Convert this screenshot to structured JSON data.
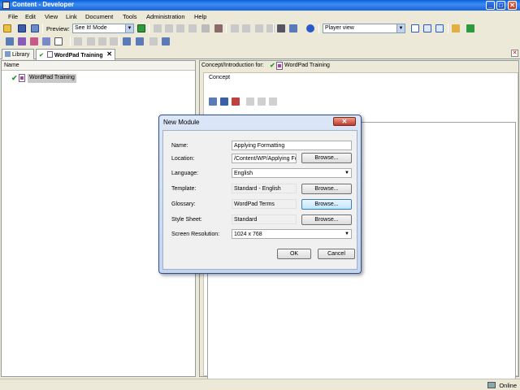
{
  "window": {
    "title": "Content - Developer",
    "controls": [
      "_",
      "□",
      "✕"
    ]
  },
  "menu": [
    "File",
    "Edit",
    "View",
    "Link",
    "Document",
    "Tools",
    "Administration",
    "Help"
  ],
  "toolbar": {
    "preview_label": "Preview:",
    "preview_mode": "See It! Mode",
    "view_mode": "Player view"
  },
  "tabs": [
    {
      "label": "Library"
    },
    {
      "label": "WordPad Training",
      "close": "✕"
    }
  ],
  "pane_close": "✕",
  "left_pane": {
    "column_header": "Name",
    "tree": [
      {
        "label": "WordPad Training",
        "checked": "✔"
      }
    ]
  },
  "right_pane": {
    "concept_for": "Concept/Introduction for:",
    "concept_title": "WordPad Training",
    "checked": "✔",
    "concept_label": "Concept"
  },
  "dialog": {
    "title": "New Module",
    "close": "✕",
    "fields": {
      "name": {
        "label": "Name:",
        "value": "Applying Formatting"
      },
      "location": {
        "label": "Location:",
        "value": "/Content/WP/Applying Fo"
      },
      "language": {
        "label": "Language:",
        "value": "English"
      },
      "template": {
        "label": "Template:",
        "value": "Standard - English"
      },
      "glossary": {
        "label": "Glossary:",
        "value": "WordPad Terms"
      },
      "stylesheet": {
        "label": "Style Sheet:",
        "value": "Standard"
      },
      "resolution": {
        "label": "Screen Resolution:",
        "value": "1024 x 768"
      }
    },
    "browse": "Browse...",
    "ok": "OK",
    "cancel": "Cancel"
  },
  "status": {
    "text": "Online"
  }
}
